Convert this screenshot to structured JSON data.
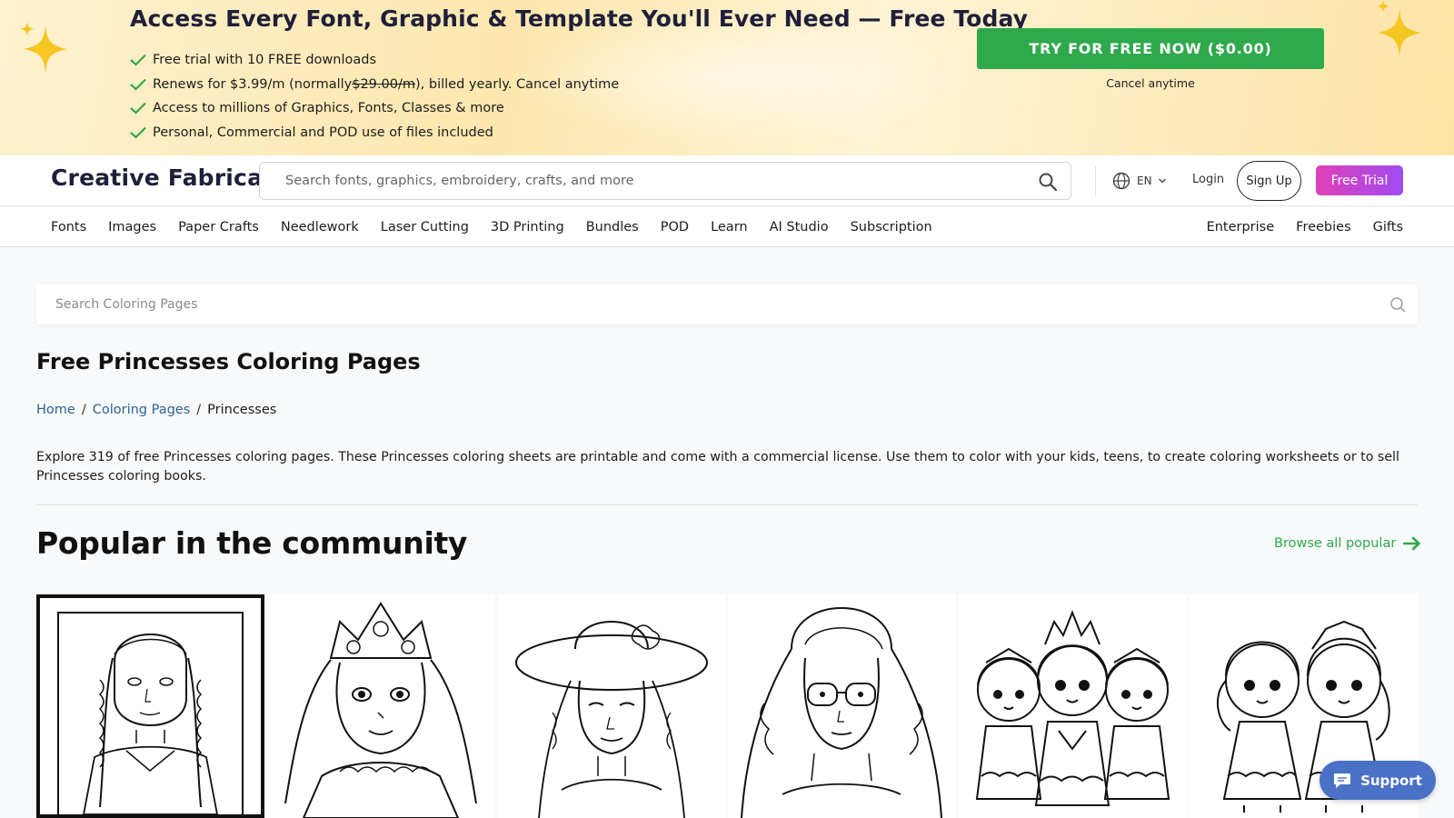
{
  "promo": {
    "title": "Access Every Font, Graphic & Template You'll Ever Need — Free Today",
    "benefit_1": "Free trial with 10 FREE downloads",
    "benefit_2_before": "Renews for $3.99/m (normally ",
    "benefit_2_strike": "$29.00/m",
    "benefit_2_after": "), billed yearly. Cancel anytime",
    "benefit_3": "Access to millions of Graphics, Fonts, Classes & more",
    "benefit_4": "Personal, Commercial and POD use of files included",
    "cta_label": "TRY FOR FREE NOW ($0.00)",
    "cta_note": "Cancel anytime",
    "cta_color": "#2ea94c"
  },
  "header": {
    "logo": "Creative Fabrica",
    "search_placeholder": "Search fonts, graphics, embroidery, crafts, and more",
    "language": "EN",
    "login": "Login",
    "signup": "Sign Up",
    "free_trial": "Free Trial"
  },
  "nav": {
    "left": [
      "Fonts",
      "Images",
      "Paper Crafts",
      "Needlework",
      "Laser Cutting",
      "3D Printing",
      "Bundles",
      "POD",
      "Learn",
      "AI Studio",
      "Subscription"
    ],
    "right": [
      "Enterprise",
      "Freebies",
      "Gifts"
    ]
  },
  "content": {
    "search_placeholder": "Search Coloring Pages",
    "title": "Free Princesses Coloring Pages",
    "breadcrumb": {
      "home": "Home",
      "section": "Coloring Pages",
      "current": "Princesses",
      "separator": "/"
    },
    "description": "Explore 319 of free Princesses coloring pages. These Princesses coloring sheets are printable and come with a commercial license. Use them to color with your kids, teens, to create coloring worksheets or to sell Princesses coloring books.",
    "section_title": "Popular in the community",
    "browse_link": "Browse all popular",
    "cards": [
      {
        "subject": "braided-girl-portrait"
      },
      {
        "subject": "princess-with-flower-crown"
      },
      {
        "subject": "girl-in-sun-hat"
      },
      {
        "subject": "girl-with-glasses"
      },
      {
        "subject": "three-chibi-princesses"
      },
      {
        "subject": "two-chibi-princesses"
      }
    ]
  },
  "support": {
    "label": "Support"
  }
}
